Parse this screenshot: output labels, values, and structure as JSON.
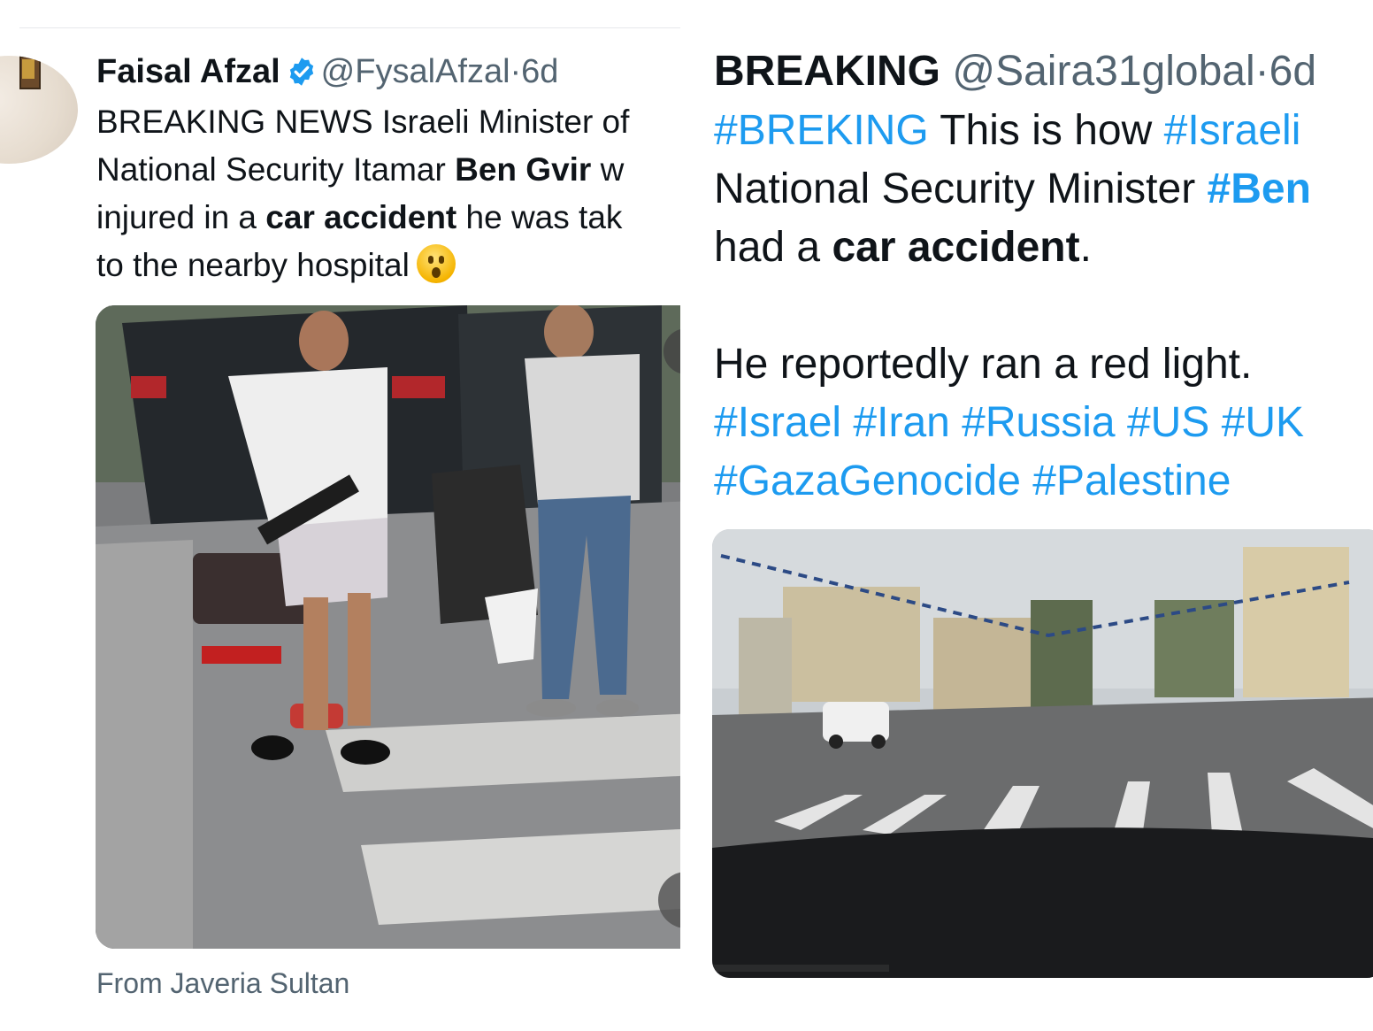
{
  "left_tweet": {
    "author_name": "Faisal Afzal",
    "handle": "@FysalAfzal",
    "separator": "·",
    "time": "6d",
    "text_line1": "BREAKING NEWS Israeli Minister of",
    "text_line2_a": "National Security Itamar ",
    "text_line2_bold": "Ben Gvir",
    "text_line2_b": " w",
    "text_line3_a": "injured in a ",
    "text_line3_bold": "car accident",
    "text_line3_b": " he was tak",
    "text_line4": "to the nearby hospital",
    "emoji": "hushed-face-emoji",
    "from_label": "From Javeria Sultan",
    "media": "video-crash-scene"
  },
  "right_tweet": {
    "author_name": "BREAKING",
    "handle": "@Saira31global",
    "separator": "·",
    "time": "6d",
    "line1_tag1": "#BREKING",
    "line1_text": " This is how ",
    "line1_tag2": "#Israeli",
    "line2_text": "National Security Minister ",
    "line2_tag": "#Ben",
    "line3_a": "had a ",
    "line3_bold": "car accident",
    "line3_b": ".",
    "line5": "He reportedly ran a red light.",
    "tags_line6": [
      "#Israel",
      "#Iran",
      "#Russia",
      "#US",
      "#UK"
    ],
    "tags_line7": [
      "#GazaGenocide",
      "#Palestine"
    ],
    "media": "dashcam-intersection-video"
  },
  "colors": {
    "link": "#1d9bf0",
    "secondary_text": "#536471",
    "verified": "#1d9bf0"
  }
}
